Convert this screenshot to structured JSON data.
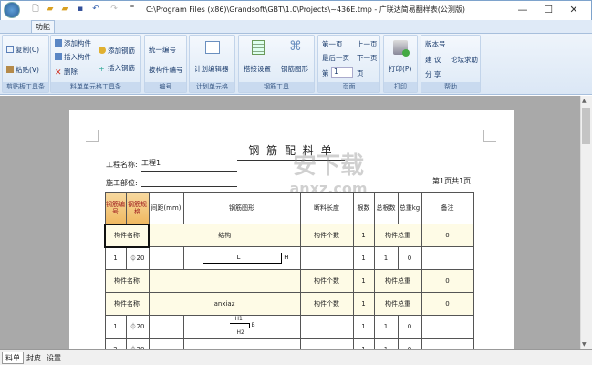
{
  "window": {
    "title": "C:\\Program Files (x86)\\Grandsoft\\GBT\\1.0\\Projects\\~436E.tmp - 广联达简易翻样表(公测版)",
    "minimize": "—",
    "maximize": "☐",
    "close": "✕"
  },
  "tabs": [
    "功能"
  ],
  "ribbon": {
    "clipboard": {
      "label": "剪贴板工具条",
      "copy": "复制(C)",
      "paste": "粘贴(V)"
    },
    "cell": {
      "label": "料单单元格工具条",
      "add_component": "添加构件",
      "insert_component": "插入构件",
      "delete": "删除",
      "add_rebar": "添加钢筋",
      "insert_rebar": "插入钢筋"
    },
    "numbering": {
      "label": "编号",
      "unify": "统一编号",
      "by_component": "按构件编号"
    },
    "plan": {
      "label": "计划单元格",
      "editor": "计划编辑器"
    },
    "rebar_tools": {
      "label": "钢筋工具",
      "splice": "搭接设置",
      "shape": "钢筋图形"
    },
    "page": {
      "label": "页面",
      "first": "第一页",
      "prev": "上一页",
      "last": "最后一页",
      "next": "下一页",
      "page_prefix": "第",
      "page_value": "1",
      "page_suffix": "页"
    },
    "print": {
      "label": "打印",
      "print": "打印(P)"
    },
    "help": {
      "label": "帮助",
      "version": "版本号",
      "suggest": "建 议",
      "forum": "论坛求助",
      "share": "分 享"
    }
  },
  "document": {
    "title": "钢 筋 配 料 单",
    "project_label": "工程名称:",
    "project_value": "工程1",
    "site_label": "施工部位:",
    "page_info": "第1页共1页",
    "headers": [
      "钢筋编号",
      "钢筋规格",
      "间距(mm)",
      "钢筋图形",
      "断料长度",
      "根数",
      "总根数",
      "总重kg",
      "备注"
    ],
    "rows": [
      {
        "type": "group",
        "name": "构件名称",
        "structure": "结构",
        "count_label": "构件个数",
        "count": "1",
        "weight_label": "构件总重",
        "weight": "0"
      },
      {
        "type": "bar",
        "no": "1",
        "spec": "⏀20",
        "shape": "L",
        "shape_h": "H",
        "n": "1",
        "total": "1",
        "kg": "0"
      },
      {
        "type": "group",
        "name": "构件名称",
        "structure": "",
        "count_label": "构件个数",
        "count": "1",
        "weight_label": "构件总重",
        "weight": "0"
      },
      {
        "type": "group",
        "name": "构件名称",
        "structure": "anxiaz",
        "count_label": "构件个数",
        "count": "1",
        "weight_label": "构件总重",
        "weight": "0"
      },
      {
        "type": "bar",
        "no": "1",
        "spec": "⏀20",
        "shape_h1": "H1",
        "shape_b": "B",
        "shape_h2": "H2",
        "n": "1",
        "total": "1",
        "kg": "0"
      },
      {
        "type": "bar",
        "no": "2",
        "spec": "⏀20",
        "n": "1",
        "total": "1",
        "kg": "0"
      }
    ]
  },
  "bottom_tabs": [
    "料单",
    "封皮",
    "设置"
  ]
}
